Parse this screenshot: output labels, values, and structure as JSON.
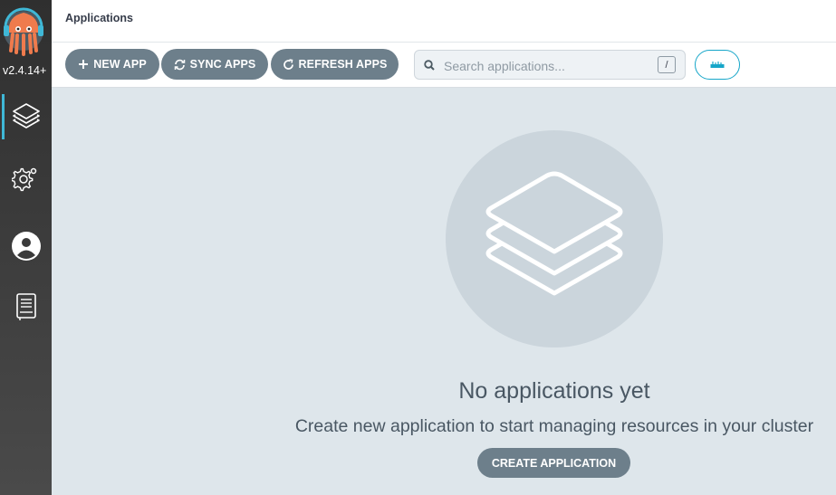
{
  "app": {
    "version": "v2.4.14+"
  },
  "header": {
    "title": "Applications"
  },
  "toolbar": {
    "new_app": "NEW APP",
    "sync_apps": "SYNC APPS",
    "refresh_apps": "REFRESH APPS",
    "search_placeholder": "Search applications...",
    "search_shortcut": "/"
  },
  "sidebar": {
    "items": [
      {
        "name": "applications",
        "icon": "layers-icon",
        "active": true
      },
      {
        "name": "settings",
        "icon": "gear-icon",
        "active": false
      },
      {
        "name": "user-info",
        "icon": "user-icon",
        "active": false
      },
      {
        "name": "documentation",
        "icon": "book-icon",
        "active": false
      }
    ]
  },
  "empty_state": {
    "icon": "layers-icon",
    "title": "No applications yet",
    "subtitle": "Create new application to start managing resources in your cluster",
    "create_button": "CREATE APPLICATION"
  },
  "colors": {
    "accent": "#16a6c9",
    "button": "#6d7f8b",
    "background": "#dee6eb"
  }
}
